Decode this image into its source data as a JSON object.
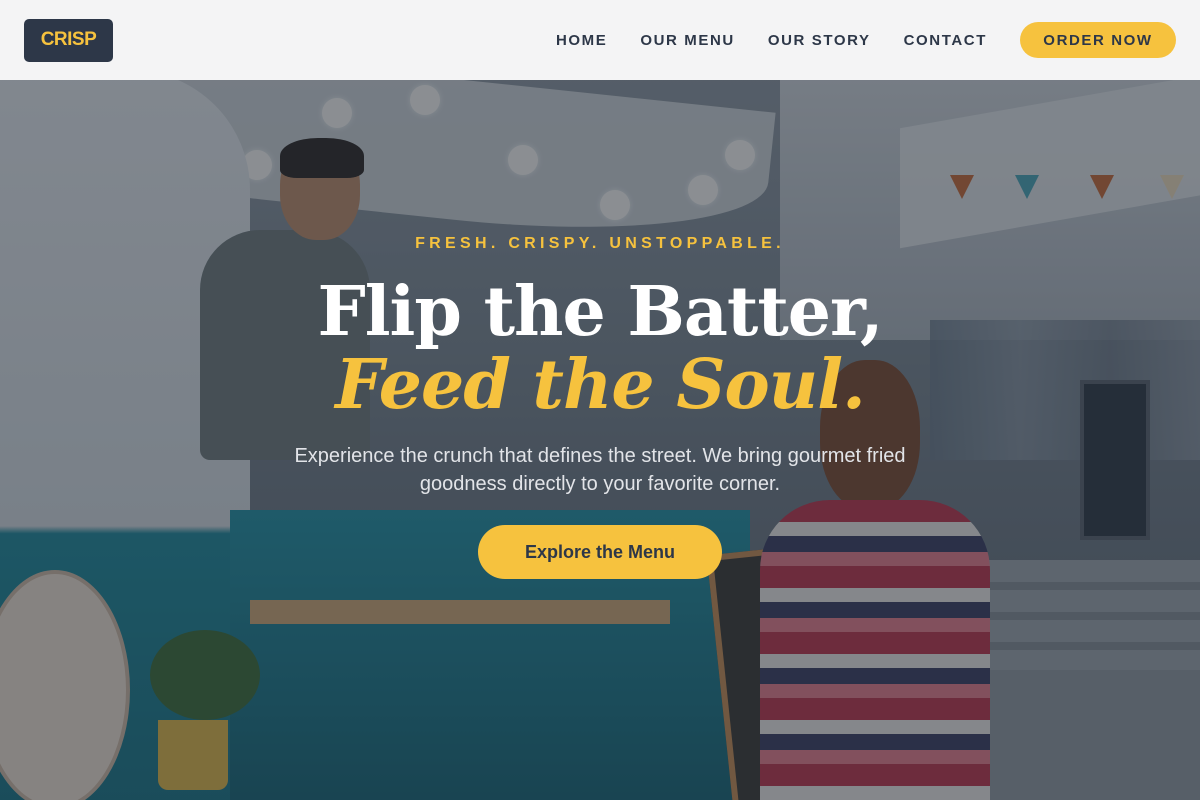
{
  "brand": {
    "logo_text": "CRISP",
    "accent_color": "#f6c23e",
    "dark_color": "#2d3748"
  },
  "nav": {
    "links": [
      {
        "label": "HOME"
      },
      {
        "label": "OUR MENU"
      },
      {
        "label": "OUR STORY"
      },
      {
        "label": "CONTACT"
      }
    ],
    "cta_label": "ORDER NOW"
  },
  "hero": {
    "tagline": "FRESH. CRISPY. UNSTOPPABLE.",
    "title_line1": "Flip the Batter,",
    "title_line2": "Feed the Soul.",
    "subtitle": "Experience the crunch that defines the street. We bring gourmet fried goodness directly to your favorite corner.",
    "cta_label": "Explore the Menu"
  }
}
